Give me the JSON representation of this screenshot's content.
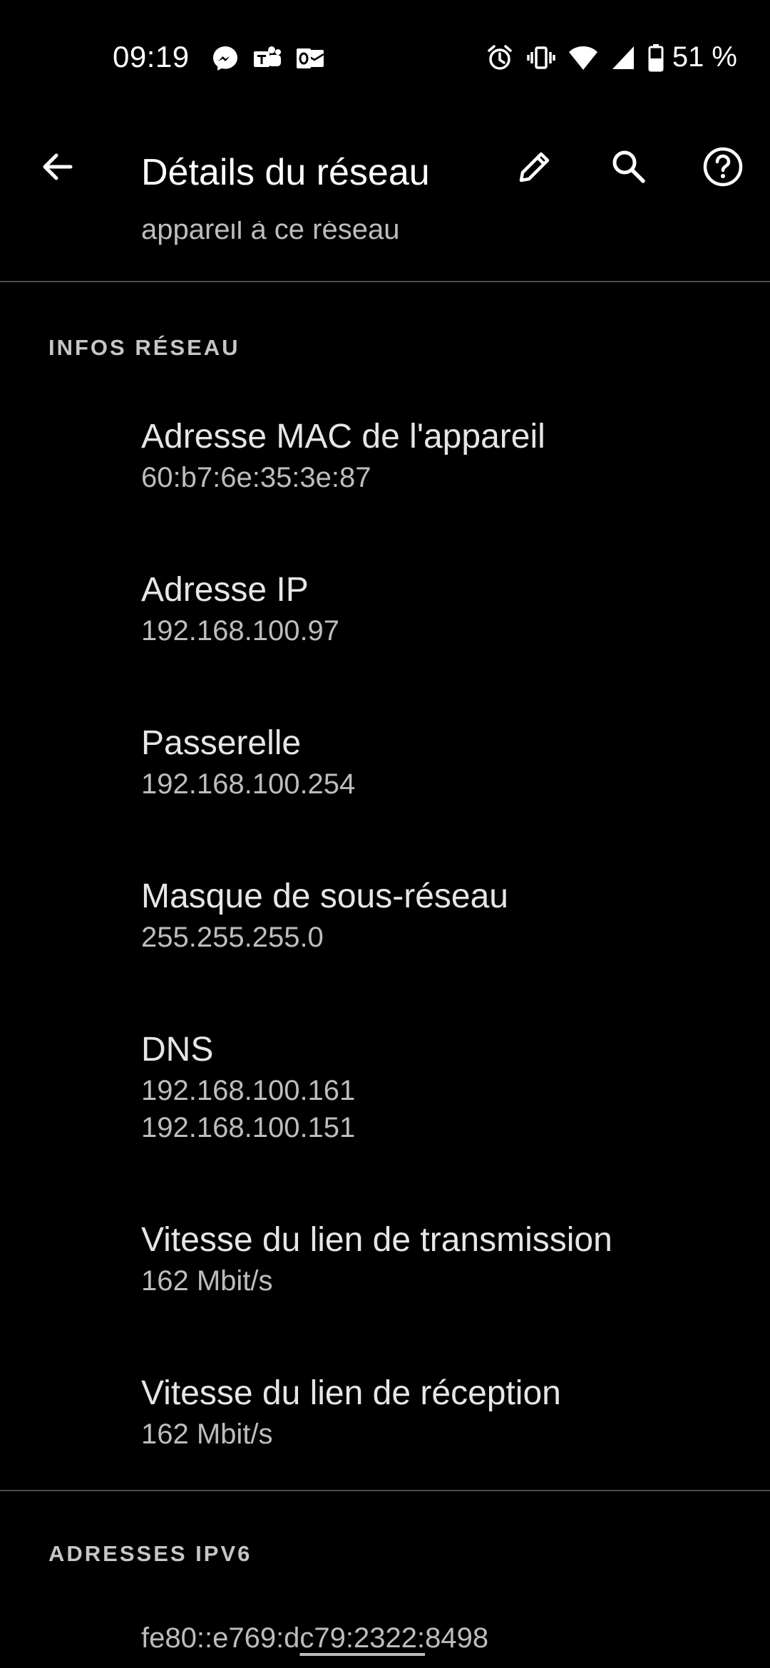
{
  "status_bar": {
    "time": "09:19",
    "notification_icons": [
      "messenger-icon",
      "teams-icon",
      "outlook-icon"
    ],
    "system_icons": [
      "alarm-icon",
      "vibrate-icon",
      "wifi-icon",
      "cellular-signal-icon",
      "battery-icon"
    ],
    "battery_percent": "51 %"
  },
  "app_bar": {
    "title": "Détails du réseau",
    "actions": [
      "edit",
      "search",
      "help"
    ]
  },
  "previous_item": {
    "summary_fragment": "appareil à ce réseau"
  },
  "network_info": {
    "header": "INFOS RÉSEAU",
    "items": [
      {
        "title": "Adresse MAC de l'appareil",
        "values": [
          "60:b7:6e:35:3e:87"
        ]
      },
      {
        "title": "Adresse IP",
        "values": [
          "192.168.100.97"
        ]
      },
      {
        "title": "Passerelle",
        "values": [
          "192.168.100.254"
        ]
      },
      {
        "title": "Masque de sous-réseau",
        "values": [
          "255.255.255.0"
        ]
      },
      {
        "title": "DNS",
        "values": [
          "192.168.100.161",
          "192.168.100.151"
        ]
      },
      {
        "title": "Vitesse du lien de transmission",
        "values": [
          "162 Mbit/s"
        ]
      },
      {
        "title": "Vitesse du lien de réception",
        "values": [
          "162 Mbit/s"
        ]
      }
    ]
  },
  "ipv6": {
    "header": "ADRESSES IPV6",
    "address_1_prefix": "fe80::e769:d",
    "address_1_selected": "c79:2322:",
    "address_1_suffix": "8498"
  },
  "colors": {
    "background": "#000000",
    "title_text": "#e6e6e6",
    "secondary_text": "#bdbdbd",
    "divider": "#4a4a4a"
  }
}
